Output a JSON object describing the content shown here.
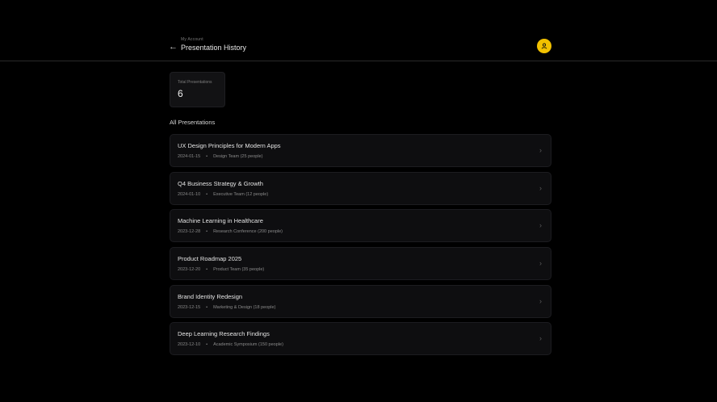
{
  "header": {
    "breadcrumb": "My Account",
    "title": "Presentation History"
  },
  "stats": {
    "label": "Total Presentations",
    "value": "6"
  },
  "section": {
    "title": "All Presentations"
  },
  "presentations": [
    {
      "title": "UX Design Principles for Modern Apps",
      "date": "2024-01-15",
      "audience": "Design Team (25 people)"
    },
    {
      "title": "Q4 Business Strategy & Growth",
      "date": "2024-01-10",
      "audience": "Executive Team (12 people)"
    },
    {
      "title": "Machine Learning in Healthcare",
      "date": "2023-12-28",
      "audience": "Research Conference (200 people)"
    },
    {
      "title": "Product Roadmap 2025",
      "date": "2023-12-20",
      "audience": "Product Team (35 people)"
    },
    {
      "title": "Brand Identity Redesign",
      "date": "2023-12-15",
      "audience": "Marketing & Design (18 people)"
    },
    {
      "title": "Deep Learning Research Findings",
      "date": "2023-12-10",
      "audience": "Academic Symposium (150 people)"
    }
  ],
  "icons": {
    "back": "arrow-left-icon",
    "avatar": "user-icon",
    "row": "chevron-right-icon"
  },
  "colors": {
    "accent": "#f2c100",
    "background": "#000000",
    "card": "#0e0e10"
  }
}
